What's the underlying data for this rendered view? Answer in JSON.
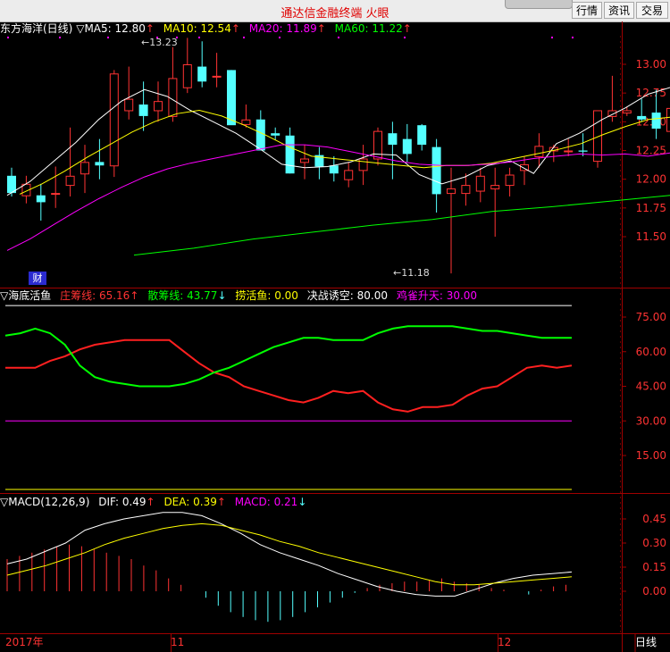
{
  "window": {
    "title": "通达信金融终端  火眼",
    "buttons": [
      "行情",
      "资讯",
      "交易"
    ]
  },
  "colors": {
    "up": "#ff3333",
    "down": "#54ffff",
    "ma5": "#ffffff",
    "ma10": "#ffff00",
    "ma20": "#ff00ff",
    "ma60": "#00ff00",
    "axis": "#a00000"
  },
  "main": {
    "stock_name": "东方海洋(日线)",
    "marker": "▽",
    "ma5": {
      "label": "MA5:",
      "value": "12.80",
      "arrow": "↑"
    },
    "ma10": {
      "label": "MA10:",
      "value": "12.54",
      "arrow": "↑"
    },
    "ma20": {
      "label": "MA20:",
      "value": "11.89",
      "arrow": "↑"
    },
    "ma60": {
      "label": "MA60:",
      "value": "11.22",
      "arrow": "↑"
    },
    "high_label": "13.23",
    "low_label": "11.18",
    "cai_badge": "财",
    "y_ticks": [
      "13.00",
      "12.75",
      "12.50",
      "12.25",
      "12.00",
      "11.75",
      "11.50"
    ]
  },
  "haidi": {
    "name": "海底活鱼",
    "marker": "▽",
    "zhuangchou": {
      "label": "庄筹线:",
      "value": "65.16",
      "arrow": "↑"
    },
    "sanchou": {
      "label": "散筹线:",
      "value": "43.77",
      "arrow": "↓"
    },
    "laohuoyu": {
      "label": "捞活鱼:",
      "value": "0.00"
    },
    "juezhan": {
      "label": "决战诱空:",
      "value": "80.00"
    },
    "queque": {
      "label": "鸡雀升天:",
      "value": "30.00"
    },
    "y_ticks": [
      "75.00",
      "60.00",
      "45.00",
      "30.00",
      "15.00"
    ]
  },
  "macd": {
    "name": "MACD(12,26,9)",
    "marker": "▽",
    "dif": {
      "label": "DIF:",
      "value": "0.49",
      "arrow": "↑"
    },
    "dea": {
      "label": "DEA:",
      "value": "0.39",
      "arrow": "↑"
    },
    "macd": {
      "label": "MACD:",
      "value": "0.21",
      "arrow": "↓"
    },
    "y_ticks": [
      "0.45",
      "0.30",
      "0.15",
      "0.00"
    ]
  },
  "x_axis": {
    "labels": [
      "2017年",
      "11",
      "12"
    ],
    "period_label": "日线"
  },
  "chart_data": [
    {
      "type": "candlestick",
      "title": "东方海洋(日线)",
      "ylim": [
        11.18,
        13.23
      ],
      "ohlc": [
        [
          12.03,
          12.1,
          11.85,
          11.88
        ],
        [
          11.86,
          12.03,
          11.79,
          11.96
        ],
        [
          11.86,
          11.96,
          11.64,
          11.8
        ],
        [
          11.88,
          12.11,
          11.75,
          11.88
        ],
        [
          11.95,
          12.45,
          11.85,
          12.03
        ],
        [
          12.05,
          12.3,
          11.88,
          12.15
        ],
        [
          12.15,
          12.35,
          12.0,
          12.12
        ],
        [
          12.12,
          12.95,
          12.02,
          12.92
        ],
        [
          12.6,
          12.98,
          12.52,
          12.7
        ],
        [
          12.65,
          12.85,
          12.42,
          12.55
        ],
        [
          12.6,
          12.85,
          12.5,
          12.68
        ],
        [
          12.55,
          13.15,
          12.5,
          12.88
        ],
        [
          12.8,
          13.23,
          12.75,
          13.0
        ],
        [
          12.98,
          13.2,
          12.8,
          12.85
        ],
        [
          12.9,
          13.1,
          12.8,
          12.9
        ],
        [
          12.95,
          12.95,
          12.55,
          12.47
        ],
        [
          12.48,
          12.65,
          12.45,
          12.52
        ],
        [
          12.52,
          12.6,
          12.25,
          12.25
        ],
        [
          12.4,
          12.45,
          12.34,
          12.38
        ],
        [
          12.38,
          12.45,
          12.05,
          12.05
        ],
        [
          12.15,
          12.3,
          12.0,
          12.18
        ],
        [
          12.21,
          12.28,
          12.0,
          12.11
        ],
        [
          12.12,
          12.2,
          11.98,
          12.05
        ],
        [
          12.0,
          12.15,
          11.93,
          12.08
        ],
        [
          12.08,
          12.3,
          11.95,
          12.18
        ],
        [
          12.18,
          12.45,
          12.12,
          12.42
        ],
        [
          12.4,
          12.5,
          12.0,
          12.3
        ],
        [
          12.35,
          12.48,
          12.15,
          12.22
        ],
        [
          12.47,
          12.48,
          12.25,
          12.3
        ],
        [
          12.28,
          12.35,
          11.71,
          11.87
        ],
        [
          11.88,
          12.1,
          11.18,
          11.92
        ],
        [
          11.88,
          12.05,
          11.77,
          11.95
        ],
        [
          11.9,
          12.1,
          11.8,
          12.03
        ],
        [
          11.92,
          12.1,
          11.5,
          11.95
        ],
        [
          11.95,
          12.1,
          11.85,
          12.04
        ],
        [
          12.08,
          12.2,
          11.95,
          12.13
        ],
        [
          12.2,
          12.4,
          12.1,
          12.29
        ],
        [
          12.25,
          12.3,
          12.15,
          12.28
        ],
        [
          12.25,
          12.35,
          12.2,
          12.25
        ],
        [
          12.25,
          12.4,
          12.2,
          12.24
        ],
        [
          12.16,
          12.6,
          12.1,
          12.6
        ],
        [
          12.55,
          12.9,
          12.5,
          12.6
        ],
        [
          12.58,
          12.63,
          12.55,
          12.6
        ],
        [
          12.55,
          12.7,
          12.5,
          12.52
        ],
        [
          12.58,
          12.78,
          12.35,
          12.44
        ],
        [
          12.42,
          12.7,
          12.32,
          12.62
        ]
      ],
      "ma5": [
        11.86,
        11.98,
        12.15,
        12.32,
        12.52,
        12.68,
        12.78,
        12.72,
        12.6,
        12.5,
        12.4,
        12.27,
        12.13,
        12.1,
        12.11,
        12.15,
        12.22,
        12.21,
        12.04,
        11.96,
        12.02,
        12.12,
        12.16,
        12.05,
        12.31,
        12.4,
        12.52,
        12.62,
        12.74,
        12.8
      ],
      "ma10": [
        11.87,
        11.96,
        12.07,
        12.19,
        12.3,
        12.41,
        12.5,
        12.57,
        12.6,
        12.55,
        12.47,
        12.38,
        12.28,
        12.2,
        12.18,
        12.16,
        12.14,
        12.12,
        12.1,
        12.12,
        12.12,
        12.14,
        12.18,
        12.22,
        12.26,
        12.31,
        12.39,
        12.46,
        12.52,
        12.54
      ],
      "ma20": [
        11.38,
        11.48,
        11.6,
        11.72,
        11.83,
        11.93,
        12.02,
        12.09,
        12.14,
        12.18,
        12.22,
        12.26,
        12.3,
        12.3,
        12.28,
        12.24,
        12.2,
        12.16,
        12.13,
        12.12,
        12.12,
        12.13,
        12.15,
        12.18,
        12.2,
        12.22,
        12.21,
        12.22,
        12.2,
        12.23
      ],
      "ma60": [
        11.34,
        11.4,
        11.48,
        11.54,
        11.6,
        11.65,
        11.72,
        11.76,
        11.81,
        11.86
      ],
      "ylabel": "",
      "xlabel": ""
    },
    {
      "type": "line",
      "title": "海底活鱼",
      "ylim": [
        0,
        82
      ],
      "series": [
        {
          "name": "庄筹线",
          "values": [
            53,
            53,
            53,
            56,
            58,
            61,
            63,
            64,
            65,
            65,
            65,
            65,
            60,
            55,
            51,
            49,
            45,
            43,
            41,
            39,
            38,
            40,
            43,
            42,
            43,
            38,
            35,
            34,
            36,
            36,
            37,
            41,
            44,
            45,
            49,
            53,
            54,
            53,
            54
          ]
        },
        {
          "name": "散筹线",
          "values": [
            67,
            68,
            70,
            68,
            63,
            54,
            49,
            47,
            46,
            45,
            45,
            45,
            46,
            48,
            51,
            53,
            56,
            59,
            62,
            64,
            66,
            66,
            65,
            65,
            65,
            68,
            70,
            71,
            71,
            71,
            71,
            70,
            69,
            69,
            68,
            67,
            66,
            66,
            66
          ]
        },
        {
          "name": "决战诱空",
          "values": [
            80
          ]
        },
        {
          "name": "鸡雀升天",
          "values": [
            30
          ]
        }
      ],
      "ylabel": "",
      "xlabel": ""
    },
    {
      "type": "line+bar",
      "title": "MACD(12,26,9)",
      "ylim": [
        -0.22,
        0.52
      ],
      "series": [
        {
          "name": "DIF",
          "values": [
            0.17,
            0.2,
            0.25,
            0.3,
            0.38,
            0.42,
            0.45,
            0.47,
            0.49,
            0.49,
            0.47,
            0.42,
            0.36,
            0.29,
            0.24,
            0.2,
            0.16,
            0.11,
            0.07,
            0.03,
            0.0,
            -0.02,
            -0.03,
            -0.03,
            0.01,
            0.05,
            0.08,
            0.1,
            0.11,
            0.12
          ]
        },
        {
          "name": "DEA",
          "values": [
            0.1,
            0.13,
            0.16,
            0.2,
            0.24,
            0.29,
            0.33,
            0.36,
            0.39,
            0.41,
            0.42,
            0.41,
            0.38,
            0.35,
            0.31,
            0.28,
            0.24,
            0.21,
            0.18,
            0.15,
            0.12,
            0.09,
            0.06,
            0.04,
            0.04,
            0.05,
            0.06,
            0.07,
            0.08,
            0.09
          ]
        },
        {
          "name": "MACD",
          "values": [
            0.2,
            0.22,
            0.24,
            0.26,
            0.28,
            0.29,
            0.28,
            0.26,
            0.24,
            0.22,
            0.2,
            0.16,
            0.13,
            0.08,
            0.04,
            0.0,
            -0.04,
            -0.09,
            -0.13,
            -0.16,
            -0.18,
            -0.19,
            -0.18,
            -0.16,
            -0.13,
            -0.1,
            -0.07,
            -0.04,
            -0.01,
            0.02,
            0.04,
            0.05,
            0.06,
            0.06,
            0.07,
            0.08,
            0.06,
            0.05,
            0.04,
            0.02,
            0.01,
            0.0,
            -0.02,
            0.01,
            0.03,
            0.04
          ]
        }
      ],
      "ylabel": "",
      "xlabel": ""
    }
  ]
}
